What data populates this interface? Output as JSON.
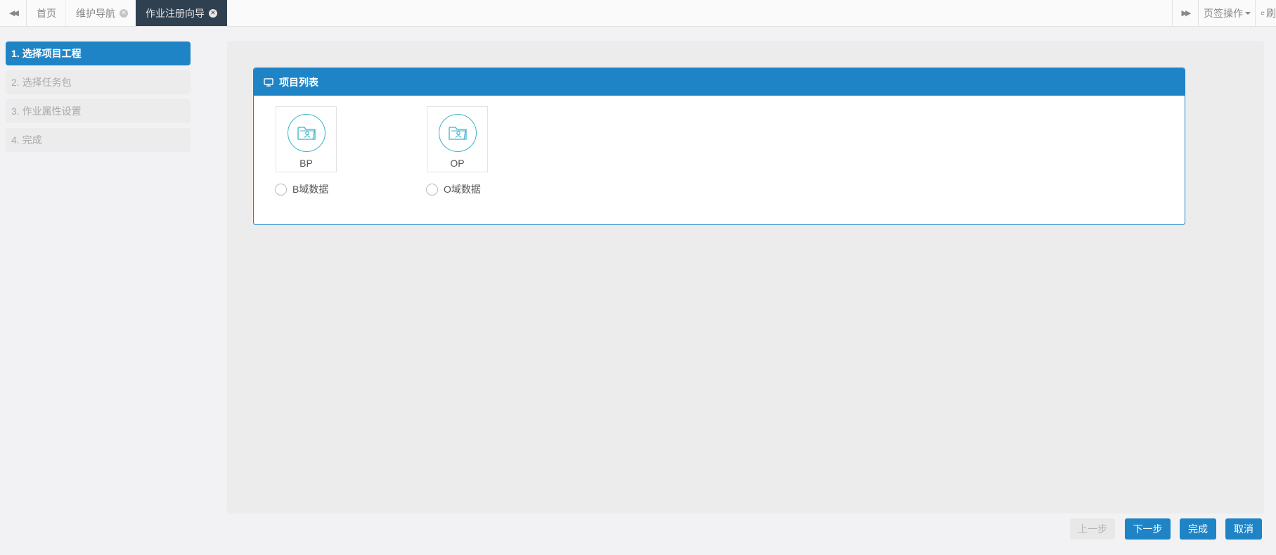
{
  "tabbar": {
    "tabs": [
      {
        "label": "首页"
      },
      {
        "label": "维护导航"
      },
      {
        "label": "作业注册向导"
      }
    ],
    "page_ops_label": "页签操作",
    "refresh_label": "刷"
  },
  "steps": [
    {
      "label": "1. 选择项目工程",
      "active": true
    },
    {
      "label": "2. 选择任务包",
      "active": false
    },
    {
      "label": "3. 作业属性设置",
      "active": false
    },
    {
      "label": "4. 完成",
      "active": false
    }
  ],
  "panel": {
    "title": "项目列表",
    "projects": [
      {
        "name": "BP",
        "radio_label": "B域数据",
        "selected": false
      },
      {
        "name": "OP",
        "radio_label": "O域数据",
        "selected": false
      }
    ]
  },
  "buttons": {
    "prev": "上一步",
    "next": "下一步",
    "finish": "完成",
    "cancel": "取消"
  },
  "colors": {
    "primary": "#1f84c6",
    "active_tab_bg": "#2f4050",
    "folder_icon": "#3ab3c9",
    "disabled_bg": "#e8e8e8"
  },
  "icons": {
    "tab_left": "double-chevron-left-icon",
    "tab_right": "double-chevron-right-icon",
    "tab_close": "close-circle-icon",
    "refresh": "refresh-icon",
    "panel": "monitor-icon",
    "project": "folder-user-icon"
  }
}
